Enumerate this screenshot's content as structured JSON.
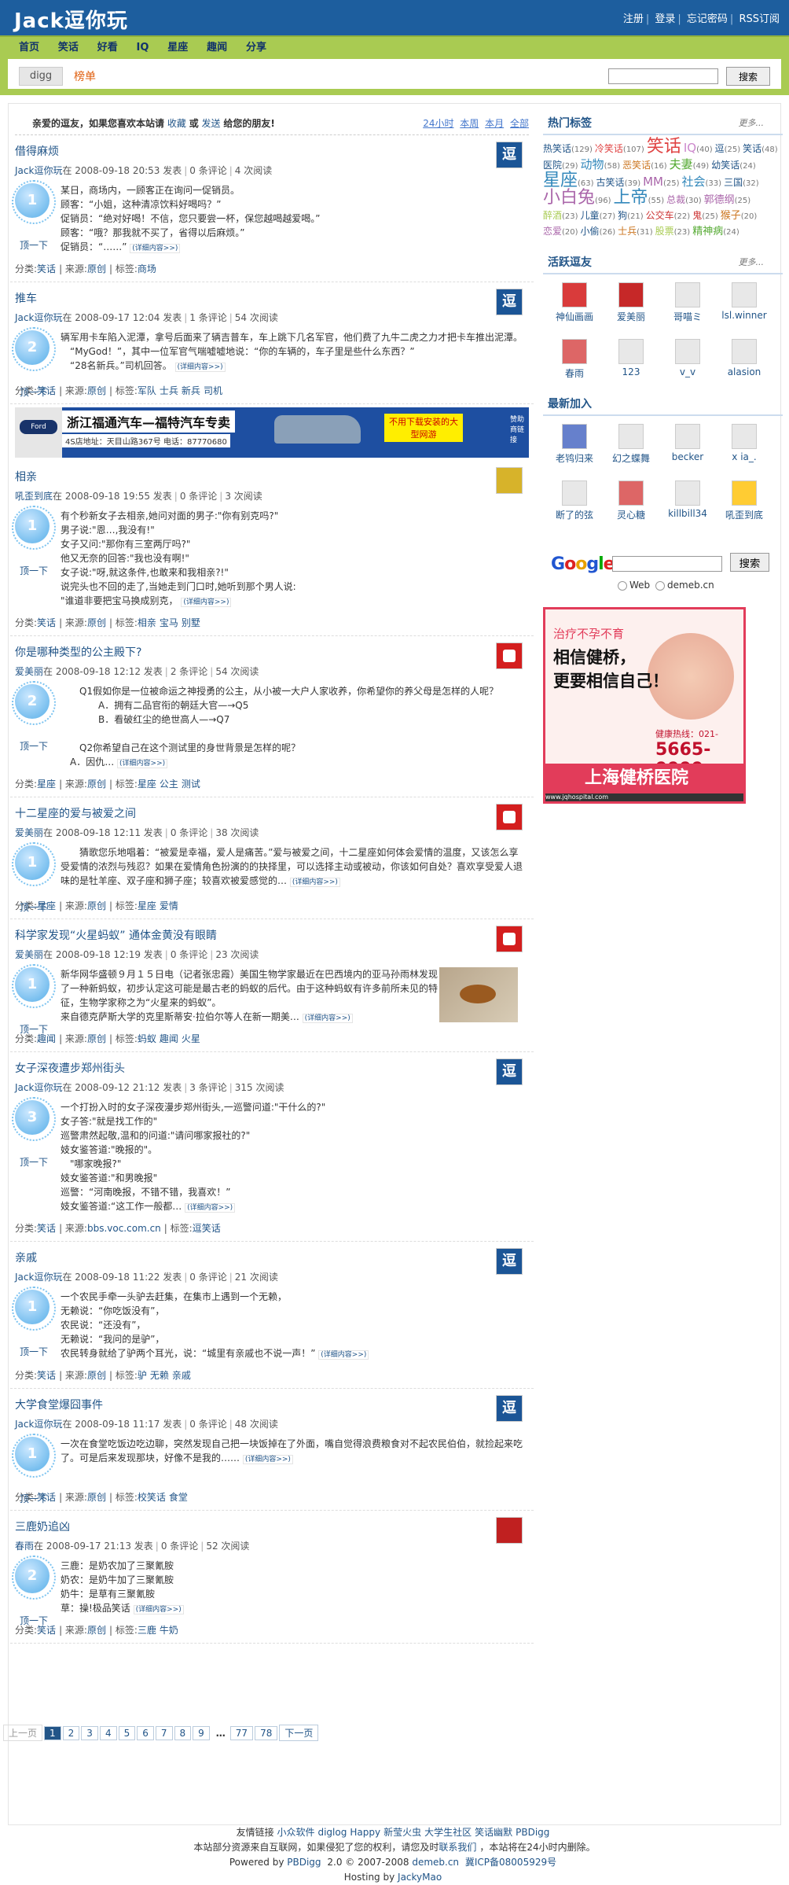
{
  "header": {
    "logo": "Jack逗你玩",
    "links": [
      "注册",
      "登录",
      "忘记密码",
      "RSS订阅"
    ]
  },
  "nav": [
    "首页",
    "笑话",
    "好看",
    "IQ",
    "星座",
    "趣闻",
    "分享"
  ],
  "subbar": {
    "tab_digg": "digg",
    "tab_rank": "榜单",
    "search_button": "搜索"
  },
  "welcome": {
    "text": "亲爱的逗友，如果您喜欢本站请",
    "fav": "收藏",
    "or": "或",
    "send": "发送",
    "text2": "给您的朋友!",
    "times": [
      "24小时",
      "本周",
      "本月",
      "全部"
    ]
  },
  "stories": [
    {
      "title": "借得麻烦",
      "author": "Jack逗你玩",
      "time": "在 2008-09-18 20:53 发表",
      "comments": "0 条评论",
      "reads": "4 次阅读",
      "count": "1",
      "digg": "顶一下",
      "body": "某日，商场内，一顾客正在询问一促销员。\n顾客：“小姐，这种清凉饮料好喝吗？”\n促销员：“绝对好喝！不信，您只要尝一杯，保您越喝越爱喝。”\n顾客：“哦？那我就不买了，省得以后麻烦。”\n促销员：“……”",
      "cat": "笑话",
      "source": "原创",
      "tags": [
        "商场"
      ]
    },
    {
      "title": "推车",
      "author": "Jack逗你玩",
      "time": "在 2008-09-17 12:04 发表",
      "comments": "1 条评论",
      "reads": "54 次阅读",
      "count": "2",
      "digg": "顶一下",
      "body": "辆军用卡车陷入泥潭，拿号后面来了辆吉普车，车上跳下几名军官，他们费了九牛二虎之力才把卡车推出泥潭。\n　“MyGod！”，其中一位军官气喘嘘嘘地说：“你的车辆的，车子里是些什么东西？”\n　“28名新兵。”司机回答。",
      "cat": "笑话",
      "source": "原创",
      "tags": [
        "军队",
        "士兵",
        "新兵",
        "司机"
      ]
    },
    {
      "title": "相亲",
      "author": "吼歪到底",
      "time": "在 2008-09-18 19:55 发表",
      "comments": "0 条评论",
      "reads": "3 次阅读",
      "count": "1",
      "digg": "顶一下",
      "body": "有个秒新女子去相亲,她问对面的男子:\"你有别克吗?\"\n男子说:\"恩…,我没有!\"\n女子又问:\"那你有三室两厅吗?\"\n他又无奈的回答:\"我也没有啊!\"\n女子说:\"呀,就这条件,也敢来和我相亲?!\"\n说完头也不回的走了,当她走到门口时,她听到那个男人说:\n\"谁道非要把宝马换成别克，",
      "cat": "笑话",
      "source": "原创",
      "tags": [
        "相亲",
        "宝马",
        "别墅"
      ]
    },
    {
      "title": "你是哪种类型的公主殿下?",
      "author": "爱美丽",
      "time": "在 2008-09-18 12:12 发表",
      "comments": "2 条评论",
      "reads": "54 次阅读",
      "count": "2",
      "digg": "顶一下",
      "body": "　　Q1假如你是一位被命运之神授勇的公主，从小被一大户人家收养，你希望你的养父母是怎样的人呢？\n　　　　A．拥有二品官衔的朝廷大官—→Q5\n　　　　B．看破红尘的绝世高人—→Q7\n\n　　Q2你希望自己在这个测试里的身世背景是怎样的呢？\n　A．因仇…",
      "cat": "星座",
      "source": "原创",
      "tags": [
        "星座",
        "公主",
        "测试"
      ]
    },
    {
      "title": "十二星座的爱与被爱之间",
      "author": "爱美丽",
      "time": "在 2008-09-18 12:11 发表",
      "comments": "0 条评论",
      "reads": "38 次阅读",
      "count": "1",
      "digg": "顶一下",
      "body": "　　猜歌您乐地唱着：“被爱是幸福，爱人是痛苦。”爱与被爱之间，十二星座如何体会爱情的温度，又该怎么享受爱情的浓烈与残忍？如果在爱情角色扮演的的抉择里，可以选择主动或被动，你该如何自处？喜欢享受爱人退味的是牡羊座、双子座和狮子座；较喜欢被爱感觉的…",
      "cat": "星座",
      "source": "原创",
      "tags": [
        "星座",
        "爱情"
      ]
    },
    {
      "title": "科学家发现“火星蚂蚁” 通体金黄没有眼睛",
      "author": "爱美丽",
      "time": "在 2008-09-18 12:19 发表",
      "comments": "0 条评论",
      "reads": "23 次阅读",
      "count": "1",
      "digg": "顶一下",
      "body": "新华网华盛顿９月１５日电（记者张忠霞）美国生物学家最近在巴西境内的亚马孙雨林发现了一种新蚂蚁，初步认定这可能是最古老的蚂蚁的后代。由于这种蚂蚁有许多前所未见的特征，生物学家称之为“火星来的蚂蚁”。\n来自德克萨斯大学的克里斯蒂安·拉伯尔等人在新一期美…",
      "cat": "趣闻",
      "source": "原创",
      "tags": [
        "蚂蚁",
        "趣闻",
        "火星"
      ]
    },
    {
      "title": "女子深夜遭步郑州街头",
      "author": "Jack逗你玩",
      "time": "在 2008-09-12 21:12 发表",
      "comments": "3 条评论",
      "reads": "315 次阅读",
      "count": "3",
      "digg": "顶一下",
      "body": "一个打扮入时的女子深夜漫步郑州街头,一巡警问道:\"干什么的?\"\n女子答:\"就是找工作的\"\n巡警肃然起敬,温和的问道:\"请问哪家报社的?\"\n妓女鉴答道:\"晚报的\"。\n　\"哪家晚报?\"\n妓女鉴答道:\"和男晚报\"\n巡警：“河南晚报，不错不错，我喜欢！”\n妓女鉴答道:“这工作一般都…",
      "cat": "笑话",
      "source": "bbs.voc.com.cn",
      "tags": [
        "逗笑话"
      ]
    },
    {
      "title": "亲戚",
      "author": "Jack逗你玩",
      "time": "在 2008-09-18 11:22 发表",
      "comments": "0 条评论",
      "reads": "21 次阅读",
      "count": "1",
      "digg": "顶一下",
      "body": "一个农民手牵一头驴去赶集，在集市上遇到一个无赖，\n无赖说：“你吃饭没有”，\n农民说：“还没有”，\n无赖说：“我问的是驴”，\n农民转身就给了驴两个耳光，说：“城里有亲戚也不说一声！”",
      "cat": "笑话",
      "source": "原创",
      "tags": [
        "驴",
        "无赖",
        "亲戚"
      ]
    },
    {
      "title": "大学食堂爆囧事件",
      "author": "Jack逗你玩",
      "time": "在 2008-09-18 11:17 发表",
      "comments": "0 条评论",
      "reads": "48 次阅读",
      "count": "1",
      "digg": "顶一下",
      "body": "一次在食堂吃饭边吃边聊，突然发现自己把一块饭掉在了外面，嘴自觉得浪费粮食对不起农民伯伯，就捡起来吃了。可是后来发现那块，好像不是我的……",
      "cat": "笑话",
      "source": "原创",
      "tags": [
        "校笑话",
        "食堂"
      ]
    },
    {
      "title": "三鹿奶追凶",
      "author": "春雨",
      "time": "在 2008-09-17 21:13 发表",
      "comments": "0 条评论",
      "reads": "52 次阅读",
      "count": "2",
      "digg": "顶一下",
      "body": "三鹿：是奶农加了三聚氰胺\n奶农：是奶牛加了三聚氰胺\n奶牛：是草有三聚氰胺\n草：操!极品笑话",
      "cat": "笑话",
      "source": "原创",
      "tags": [
        "三鹿",
        "牛奶"
      ]
    }
  ],
  "labels": {
    "cat": "分类:",
    "source": "来源:",
    "tags": "标签:",
    "more": "(详细内容>>)"
  },
  "ad1": {
    "logo": "Ford",
    "title": "浙江福通汽车—福特汽车专卖",
    "address": "4S店地址：天目山路367号  电话：87770680",
    "right1": "不用下载安装的大型网游",
    "right2": "赞助商链接"
  },
  "pager": {
    "prev": "上一页",
    "pages": [
      "1",
      "2",
      "3",
      "4",
      "5",
      "6",
      "7",
      "8",
      "9"
    ],
    "ellipsis": "…",
    "tail": [
      "77",
      "78"
    ],
    "next": "下一页"
  },
  "right": {
    "hot_tags_title": "热门标签",
    "more": "更多...",
    "tags": [
      {
        "t": "热笑话",
        "n": "(129)",
        "c": "#225588",
        "s": 12
      },
      {
        "t": "冷笑话",
        "n": "(107)",
        "c": "#e04444",
        "s": 12
      },
      {
        "t": "笑话",
        "n": "",
        "c": "#e04444",
        "s": 22
      },
      {
        "t": "IQ",
        "n": "(40)",
        "c": "#cc88cc",
        "s": 15
      },
      {
        "t": "逗",
        "n": "(25)",
        "c": "#225588",
        "s": 12
      },
      {
        "t": "笑话",
        "n": "(48)",
        "c": "#225588",
        "s": 12
      },
      {
        "t": "医院",
        "n": "(29)",
        "c": "#225588",
        "s": 12
      },
      {
        "t": "动物",
        "n": "(58)",
        "c": "#3388bb",
        "s": 15
      },
      {
        "t": "恶笑话",
        "n": "(16)",
        "c": "#cc7722",
        "s": 12
      },
      {
        "t": "夫妻",
        "n": "(49)",
        "c": "#55aa33",
        "s": 15
      },
      {
        "t": "幼笑话",
        "n": "(24)",
        "c": "#225588",
        "s": 12
      },
      {
        "t": "星座",
        "n": "(63)",
        "c": "#3388bb",
        "s": 22
      },
      {
        "t": "古笑话",
        "n": "(39)",
        "c": "#225588",
        "s": 12
      },
      {
        "t": "MM",
        "n": "(25)",
        "c": "#aa66aa",
        "s": 15
      },
      {
        "t": "社会",
        "n": "(33)",
        "c": "#3388bb",
        "s": 15
      },
      {
        "t": "三国",
        "n": "(32)",
        "c": "#225588",
        "s": 12
      },
      {
        "t": "小白兔",
        "n": "(96)",
        "c": "#aa66aa",
        "s": 22
      },
      {
        "t": "上帝",
        "n": "(55)",
        "c": "#3388bb",
        "s": 22
      },
      {
        "t": "总裁",
        "n": "(30)",
        "c": "#aa66aa",
        "s": 12
      },
      {
        "t": "郭德纲",
        "n": "(25)",
        "c": "#aa66aa",
        "s": 13
      },
      {
        "t": "醉酒",
        "n": "(23)",
        "c": "#aacc55",
        "s": 12
      },
      {
        "t": "儿童",
        "n": "(27)",
        "c": "#225588",
        "s": 12
      },
      {
        "t": "狗",
        "n": "(21)",
        "c": "#225588",
        "s": 12
      },
      {
        "t": "公交车",
        "n": "(22)",
        "c": "#cc3333",
        "s": 12
      },
      {
        "t": "鬼",
        "n": "(25)",
        "c": "#cc3333",
        "s": 12
      },
      {
        "t": "猴子",
        "n": "(20)",
        "c": "#cc7722",
        "s": 13
      },
      {
        "t": "恋爱",
        "n": "(20)",
        "c": "#aa66aa",
        "s": 12
      },
      {
        "t": "小偷",
        "n": "(26)",
        "c": "#225588",
        "s": 12
      },
      {
        "t": "士兵",
        "n": "(31)",
        "c": "#cc7722",
        "s": 12
      },
      {
        "t": "股票",
        "n": "(23)",
        "c": "#aacc55",
        "s": 12
      },
      {
        "t": "精神病",
        "n": "(24)",
        "c": "#55aa33",
        "s": 13
      }
    ],
    "active_title": "活跃逗友",
    "active": [
      {
        "name": "神仙画画",
        "c": "w"
      },
      {
        "name": "爱美丽",
        "c": "r"
      },
      {
        "name": "哥喵ミ",
        "c": "g"
      },
      {
        "name": "lsl.winner",
        "c": "g"
      },
      {
        "name": "春雨",
        "c": "p"
      },
      {
        "name": "123",
        "c": "g"
      },
      {
        "name": "v_v",
        "c": "g"
      },
      {
        "name": "alasion",
        "c": "g"
      }
    ],
    "new_title": "最新加入",
    "newusers": [
      {
        "name": "老鸨归来",
        "c": "b"
      },
      {
        "name": "幻之蝶舞",
        "c": "g"
      },
      {
        "name": "becker",
        "c": "g"
      },
      {
        "name": "x ia_.",
        "c": "g"
      },
      {
        "name": "断了的弦",
        "c": "g"
      },
      {
        "name": "灵心糖",
        "c": "p"
      },
      {
        "name": "killbill34",
        "c": "g"
      },
      {
        "name": "吼歪到底",
        "c": "y"
      }
    ],
    "google": {
      "button": "搜索",
      "opt1": "Web",
      "opt2": "demeb.cn"
    },
    "hosp": {
      "h1": "治疗不孕不育",
      "h2a": "相信健桥，",
      "h2b": "更要相信自己！",
      "tel_label": "健康热线：021-",
      "tel": "5665-9999",
      "name": "上海健桥医院",
      "foot": "www.jqhospital.com"
    }
  },
  "footer": {
    "friends_label": "友情链接",
    "friends": [
      "小众软件",
      "diglog",
      "Happy",
      "新莹火虫",
      "大学生社区",
      "笑话幽默",
      "PBDigg"
    ],
    "line2": "本站部分资源来自互联网，如果侵犯了您的权利，请您及时",
    "contact": "联系我们",
    "line2b": "，本站将在24小时内删除。",
    "line3a": "Powered by",
    "pbdigg": "PBDigg",
    "line3b": "2.0 © 2007-2008",
    "site": "demeb.cn",
    "icp": "冀ICP备08005929号",
    "line4a": "Hosting by",
    "jacky": "JackyMao"
  }
}
